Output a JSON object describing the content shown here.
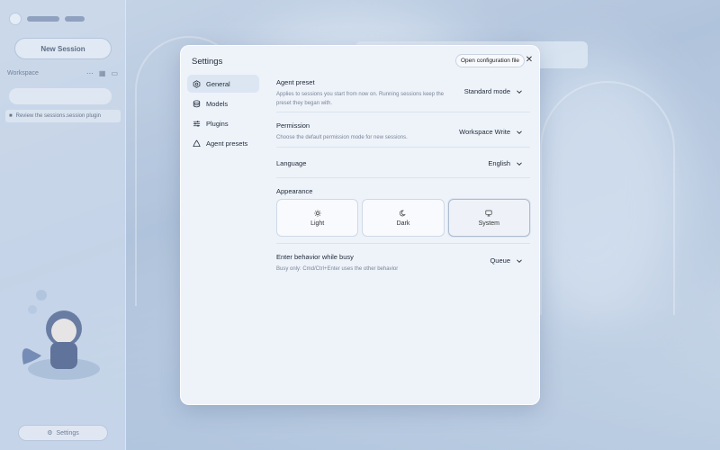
{
  "sidebar": {
    "new_session_label": "New Session",
    "workspace_label": "Workspace",
    "session_item": "Review the sessions.session plugin",
    "bottom_label": "Settings"
  },
  "modal": {
    "title": "Settings",
    "open_config_label": "Open configuration file",
    "close_label": "✕"
  },
  "nav": {
    "items": [
      {
        "label": "General",
        "icon": "hexagon-icon",
        "active": true
      },
      {
        "label": "Models",
        "icon": "database-icon",
        "active": false
      },
      {
        "label": "Plugins",
        "icon": "sliders-icon",
        "active": false
      },
      {
        "label": "Agent presets",
        "icon": "recycle-icon",
        "active": false
      }
    ]
  },
  "settings": {
    "agent_preset": {
      "title": "Agent preset",
      "description": "Applies to sessions you start from now on. Running sessions keep the preset they began with.",
      "value": "Standard mode"
    },
    "permission": {
      "title": "Permission",
      "description": "Choose the default permission mode for new sessions.",
      "value": "Workspace Write"
    },
    "language": {
      "title": "Language",
      "value": "English"
    },
    "appearance": {
      "title": "Appearance",
      "options": [
        {
          "label": "Light",
          "icon": "sun-icon"
        },
        {
          "label": "Dark",
          "icon": "moon-icon"
        },
        {
          "label": "System",
          "icon": "monitor-icon"
        }
      ],
      "selected": "System"
    },
    "busy_behavior": {
      "title": "Enter behavior while busy",
      "description": "Busy only: Cmd/Ctrl+Enter uses the other behavior",
      "value": "Queue"
    }
  },
  "colors": {
    "modal_bg": "#eef3fa",
    "active_nav": "#dce6f3",
    "text": "#1f2937",
    "muted": "#7a8596"
  }
}
